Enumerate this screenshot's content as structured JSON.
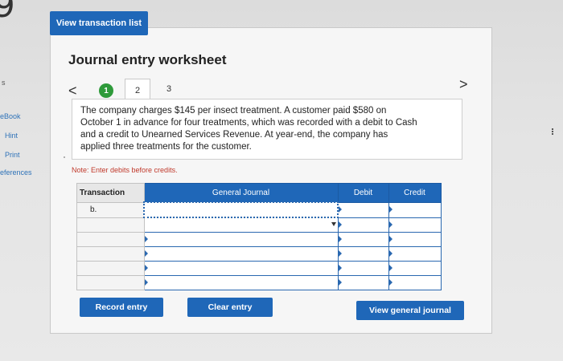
{
  "frag": {
    "number": "9",
    "letter": "s",
    "links": [
      "eBook",
      "Hint",
      "Print",
      "eferences"
    ]
  },
  "tabs": {
    "view_transaction_list": "View transaction list"
  },
  "worksheet": {
    "title": "Journal entry worksheet",
    "pager": {
      "prev": "<",
      "steps": [
        "1",
        "2",
        "3"
      ],
      "next": ">"
    },
    "prompt": "The company charges $145 per insect treatment. A customer paid $580 on October 1 in advance for four treatments, which was recorded with a debit to Cash and a credit to Unearned Services Revenue. At year-end, the company has applied three treatments for the customer.",
    "note": "Note: Enter debits before credits.",
    "table": {
      "headers": [
        "Transaction",
        "General Journal",
        "Debit",
        "Credit"
      ],
      "transaction": "b."
    },
    "buttons": {
      "record": "Record entry",
      "clear": "Clear entry",
      "view": "View general journal"
    }
  }
}
